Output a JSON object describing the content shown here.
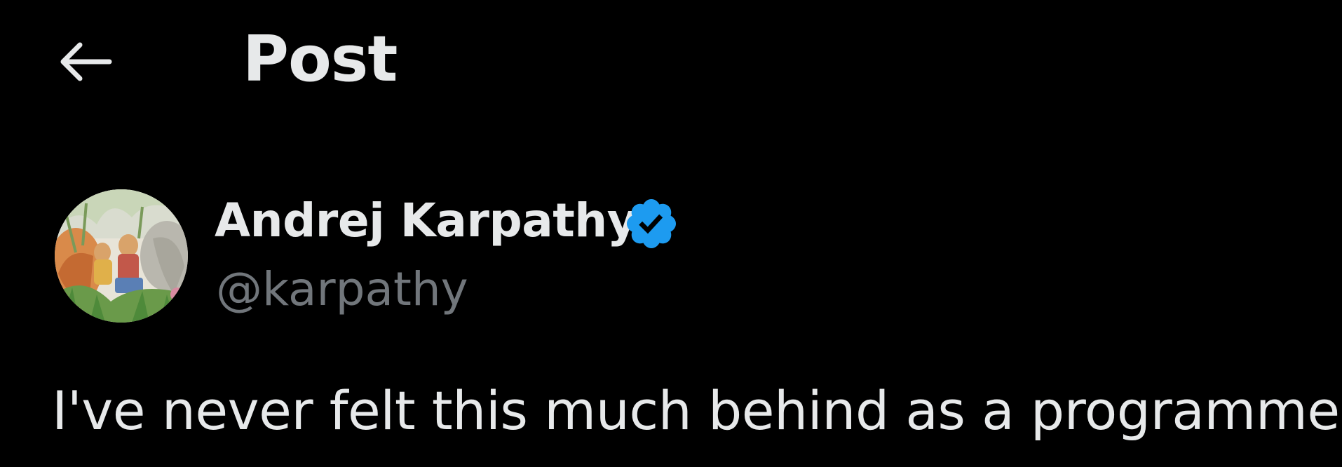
{
  "header": {
    "back_icon": "arrow-left-icon",
    "title": "Post"
  },
  "author": {
    "display_name": "Andrej Karpathy",
    "handle": "@karpathy",
    "verified_icon": "verified-badge-icon",
    "avatar_icon": "profile-avatar"
  },
  "post": {
    "text": "I've never felt this much behind as a programmer."
  },
  "colors": {
    "background": "#000000",
    "primary_text": "#e7e9ea",
    "secondary_text": "#71767b",
    "verified_blue": "#1d9bf0"
  }
}
